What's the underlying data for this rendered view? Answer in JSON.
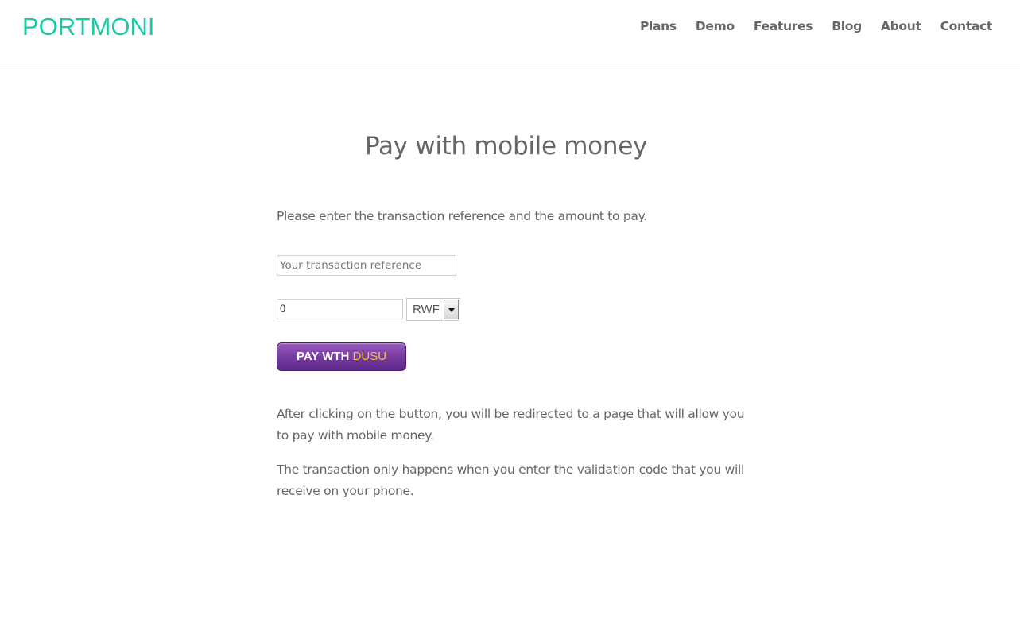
{
  "header": {
    "logo": "PORTMONI",
    "nav": [
      {
        "label": "Plans"
      },
      {
        "label": "Demo"
      },
      {
        "label": "Features"
      },
      {
        "label": "Blog"
      },
      {
        "label": "About"
      },
      {
        "label": "Contact"
      }
    ]
  },
  "main": {
    "title": "Pay with mobile money",
    "intro": "Please enter the transaction reference and the amount to pay.",
    "reference_input": {
      "value": "",
      "placeholder": "Your transaction reference"
    },
    "amount_input": {
      "value": "0"
    },
    "currency_select": {
      "selected": "RWF"
    },
    "pay_button": {
      "label": "PAY WTH",
      "brand": "DUSU"
    },
    "paragraphs": [
      "After clicking on the button, you will be redirected to a page that will allow you to pay with mobile money.",
      "The transaction only happens when you enter the validation code that you will receive on your phone."
    ]
  },
  "colors": {
    "brand": "#1cc9a4",
    "text": "#666666",
    "button_purple": "#7a3ea3",
    "button_brand_text": "#f0c430"
  }
}
